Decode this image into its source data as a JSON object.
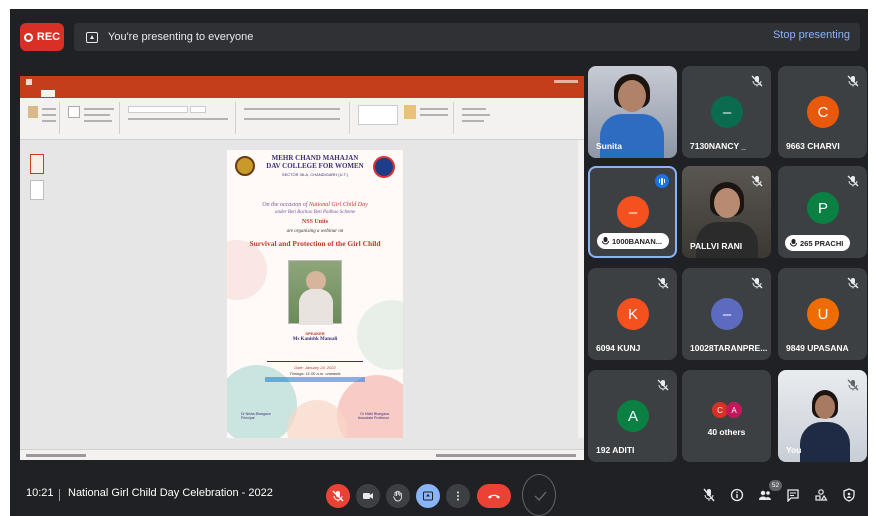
{
  "topbar": {
    "rec_label": "REC",
    "presenting_text": "You're presenting to everyone",
    "stop_label": "Stop presenting"
  },
  "slide": {
    "college_line1": "MEHR CHAND MAHAJAN",
    "college_line2": "DAV COLLEGE FOR WOMEN",
    "address": "SECTOR 36-A, CHANDIGARH (U.T.)",
    "occasion_prefix": "On the occasion of ",
    "occasion_highlight": "National Girl Child Day",
    "scheme": "under Beti Bachao Beti Padhao Scheme",
    "unit": "NSS Units",
    "organising": "are organising a webinar on",
    "topic": "Survival and Protection of the Girl Child",
    "speaker_label": "SPEAKER",
    "speaker_name": "Ms Kanishk Mansali",
    "date_line": "Date: January 24, 2022",
    "time_line": "Timings: 11.00 a.m. onwards",
    "sig_left": "Dr Nisha Bhargava\nPrincipal",
    "sig_right": "Dr Nidhi Bhargava\nAssociate Professor"
  },
  "participants": [
    {
      "name": "Sunita",
      "type": "video",
      "muted": false
    },
    {
      "name": "7130NANCY _",
      "initial": "–",
      "color": "#0b6b4f",
      "muted": true
    },
    {
      "name": "9663 CHARVI",
      "initial": "C",
      "color": "#e8590c",
      "muted": true
    },
    {
      "name": "1000BANAN...",
      "initial": "–",
      "color": "#f4511e",
      "muted": false,
      "speaking": true,
      "pill": true
    },
    {
      "name": "PALLVI RANI",
      "type": "video",
      "muted": true
    },
    {
      "name": "265 PRACHI",
      "initial": "P",
      "color": "#0b8043",
      "muted": true,
      "pill": true
    },
    {
      "name": "6094 KUNJ",
      "initial": "K",
      "color": "#f4511e",
      "muted": true
    },
    {
      "name": "10028TARANPRE...",
      "initial": "–",
      "color": "#5c6bc0",
      "muted": true
    },
    {
      "name": "9849 UPASANA",
      "initial": "U",
      "color": "#ef6c00",
      "muted": true
    },
    {
      "name": "192 ADITI",
      "initial": "A",
      "color": "#0b8043",
      "muted": true
    },
    {
      "name": "40 others",
      "initials": [
        "C",
        "A"
      ],
      "colors": [
        "#d93025",
        "#c2185b"
      ]
    },
    {
      "name": "You",
      "type": "video",
      "muted": true
    }
  ],
  "bottombar": {
    "time": "10:21",
    "meeting_title": "National Girl Child Day Celebration - 2022",
    "participant_count": "52"
  },
  "colors": {
    "meet_bg": "#202124",
    "tile_bg": "#3c4043",
    "ppt_accent": "#c43e1c",
    "end_call": "#ea4335",
    "present_blue": "#8ab4f8"
  }
}
